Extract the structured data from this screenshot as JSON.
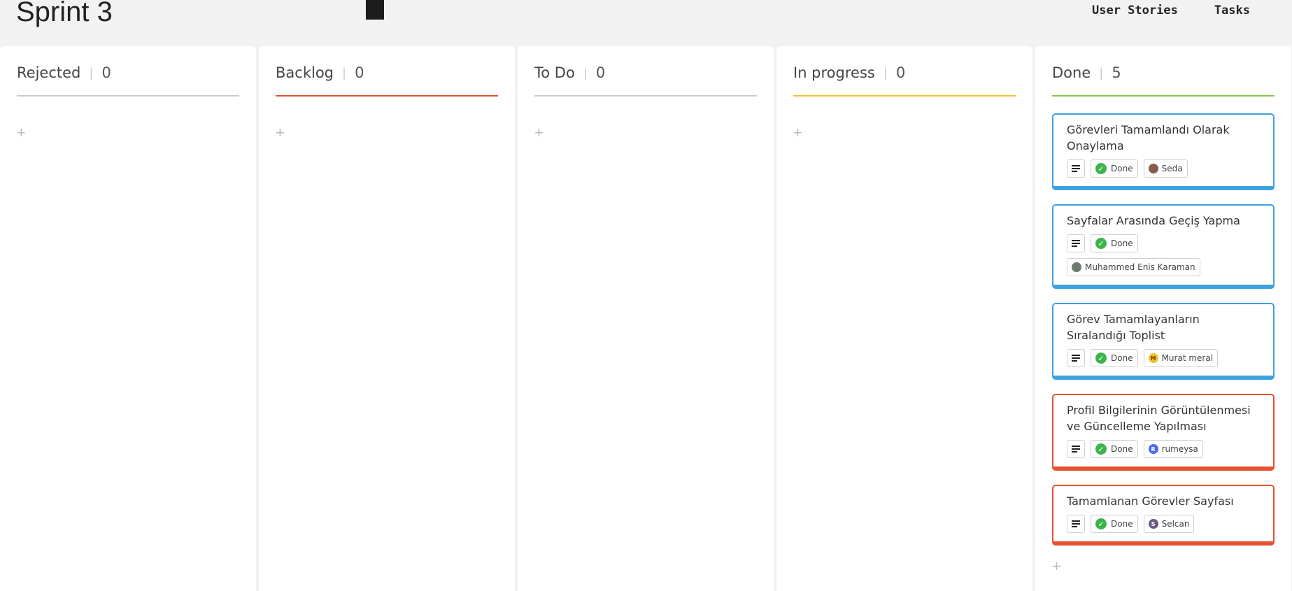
{
  "page": {
    "title": "Sprint 3"
  },
  "nav": {
    "user_stories": "User Stories",
    "tasks": "Tasks"
  },
  "columns": [
    {
      "name": "Rejected",
      "count": "0",
      "accent": "#cccccc"
    },
    {
      "name": "Backlog",
      "count": "0",
      "accent": "#e4522f"
    },
    {
      "name": "To Do",
      "count": "0",
      "accent": "#cccccc"
    },
    {
      "name": "In progress",
      "count": "0",
      "accent": "#f2c12e"
    },
    {
      "name": "Done",
      "count": "5",
      "accent": "#8bc34a"
    }
  ],
  "add_symbol": "+",
  "cards": [
    {
      "title": "Görevleri Tamamlandı Olarak Onaylama",
      "status": "Done",
      "assignee": "Seda",
      "assignee_initial": "",
      "avatar_color": "#8a5a4a",
      "border": "#3fa0e0"
    },
    {
      "title": "Sayfalar Arasında Geçiş Yapma",
      "status": "Done",
      "assignee": "Muhammed Enis Karaman",
      "assignee_initial": "",
      "avatar_color": "#6b7b6b",
      "border": "#3fa0e0"
    },
    {
      "title": "Görev Tamamlayanların Sıralandığı Toplist",
      "status": "Done",
      "assignee": "Murat meral",
      "assignee_initial": "M",
      "avatar_color": "#f2c12e",
      "border": "#3fa0e0"
    },
    {
      "title": "Profil Bilgilerinin Görüntülenmesi ve Güncelleme Yapılması",
      "status": "Done",
      "assignee": "rumeysa",
      "assignee_initial": "R",
      "avatar_color": "#4a6cf0",
      "border": "#e4522f"
    },
    {
      "title": "Tamamlanan Görevler Sayfası",
      "status": "Done",
      "assignee": "Selcan",
      "assignee_initial": "S",
      "avatar_color": "#6a5a8a",
      "border": "#e4522f"
    }
  ],
  "colors": {
    "status_done": "#3bb54a",
    "background": "#f2f2f2"
  }
}
